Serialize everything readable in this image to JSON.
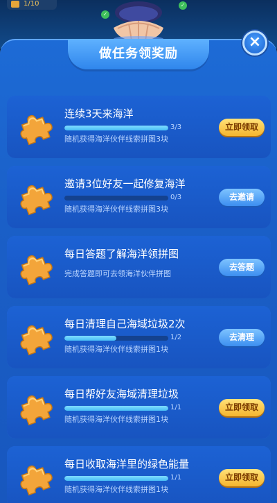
{
  "header": {
    "counter": "1/10",
    "drop_icon": "leaf-drop-icon"
  },
  "dialog": {
    "title": "做任务领奖励",
    "close_icon": "close-icon"
  },
  "tasks": [
    {
      "title": "连续3天来海洋",
      "progress_text": "3/3",
      "progress": 1.0,
      "desc": "随机获得海洋伙伴线索拼图3块",
      "button": "立即领取",
      "button_style": "gold"
    },
    {
      "title": "邀请3位好友一起修复海洋",
      "progress_text": "0/3",
      "progress": 0.0,
      "desc": "随机获得海洋伙伴线索拼图3块",
      "button": "去邀请",
      "button_style": "blue"
    },
    {
      "title": "每日答题了解海洋领拼图",
      "progress_text": "",
      "progress": null,
      "desc": "完成答题即可去领海洋伙伴拼图",
      "button": "去答题",
      "button_style": "blue"
    },
    {
      "title": "每日清理自己海域垃圾2次",
      "progress_text": "1/2",
      "progress": 0.5,
      "desc": "随机获得海洋伙伴线索拼图1块",
      "button": "去清理",
      "button_style": "blue"
    },
    {
      "title": "每日帮好友海域清理垃圾",
      "progress_text": "1/1",
      "progress": 1.0,
      "desc": "随机获得海洋伙伴线索拼图1块",
      "button": "立即领取",
      "button_style": "gold"
    },
    {
      "title": "每日收取海洋里的绿色能量",
      "progress_text": "1/1",
      "progress": 1.0,
      "desc": "随机获得海洋伙伴线索拼图1块",
      "button": "立即领取",
      "button_style": "gold"
    }
  ],
  "colors": {
    "panel": "#1d6bd6",
    "card": "#1c62d4",
    "progress_fill": "#49bff6",
    "gold_button": "#f5b52e",
    "blue_button": "#3c8ef0"
  },
  "icons": {
    "task_icon": "puzzle-piece-icon",
    "shell": "clam-shell-icon"
  }
}
